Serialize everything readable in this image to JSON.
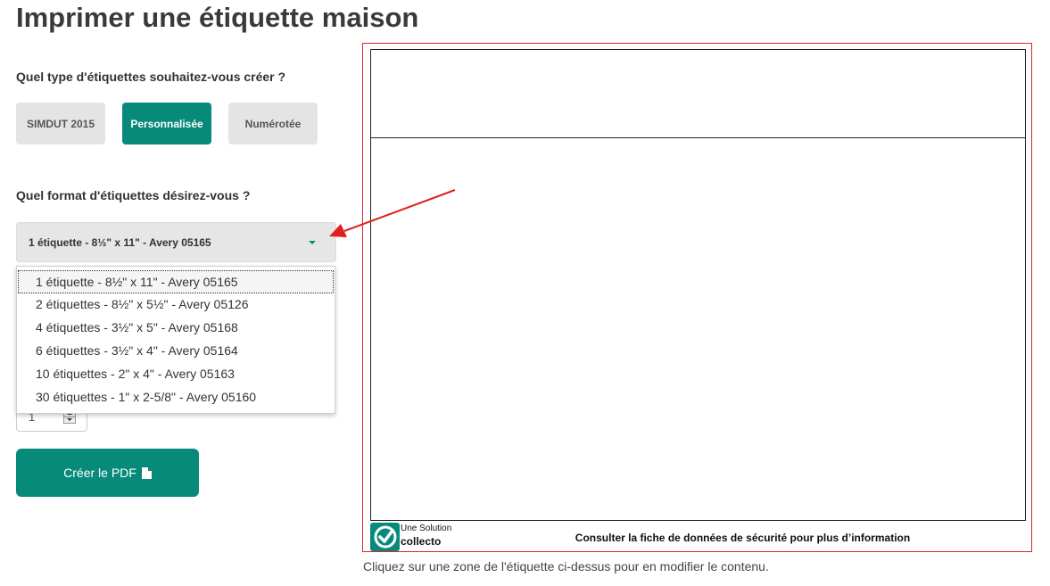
{
  "page": {
    "title": "Imprimer une étiquette maison"
  },
  "label_type": {
    "question": "Quel type d'étiquettes souhaitez-vous créer ?",
    "options": [
      {
        "label": "SIMDUT 2015",
        "active": false
      },
      {
        "label": "Personnalisée",
        "active": true
      },
      {
        "label": "Numérotée",
        "active": false
      }
    ]
  },
  "label_format": {
    "question": "Quel format d'étiquettes désirez-vous ?",
    "selected": "1 étiquette - 8½\" x 11\" - Avery 05165",
    "options": [
      "1 étiquette - 8½\" x 11\" - Avery 05165",
      "2 étiquettes - 8½\" x 5½\" - Avery 05126",
      "4 étiquettes - 3½\" x 5\" - Avery 05168",
      "6 étiquettes - 3½\" x 4\" - Avery 05164",
      "10 étiquettes - 2\" x 4\" - Avery 05163",
      "30 étiquettes - 1\" x 2-5/8\" - Avery 05160"
    ]
  },
  "quantity": {
    "value": "1"
  },
  "pdf_button": {
    "label": "Créer le PDF",
    "icon": "file-icon"
  },
  "preview": {
    "brand_tagline": "Une Solution",
    "brand_name": "collecto",
    "footer_text": "Consulter la fiche de données de sécurité pour plus d’information",
    "help_text": "Cliquez sur une zone de l'étiquette ci-dessus pour en modifier le contenu."
  },
  "colors": {
    "accent": "#078a7a",
    "frame": "#d9262b",
    "arrow": "#e02020",
    "button_gray": "#e4e4e4"
  }
}
